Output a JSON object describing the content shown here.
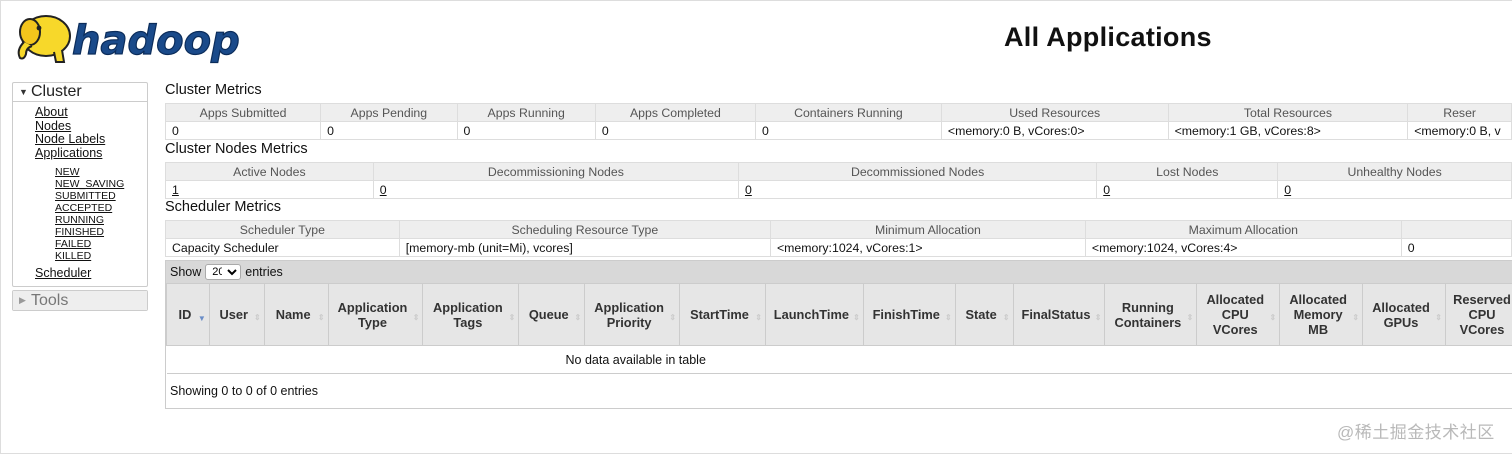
{
  "header": {
    "logo_text": "hadoop",
    "title": "All Applications"
  },
  "nav": {
    "cluster_label": "Cluster",
    "cluster_items": [
      "About",
      "Nodes",
      "Node Labels",
      "Applications"
    ],
    "app_states": [
      "NEW",
      "NEW_SAVING",
      "SUBMITTED",
      "ACCEPTED",
      "RUNNING",
      "FINISHED",
      "FAILED",
      "KILLED"
    ],
    "scheduler": "Scheduler",
    "tools_label": "Tools"
  },
  "cluster_metrics": {
    "title": "Cluster Metrics",
    "headers": [
      "Apps Submitted",
      "Apps Pending",
      "Apps Running",
      "Apps Completed",
      "Containers Running",
      "Used Resources",
      "Total Resources",
      "Reser"
    ],
    "values": [
      "0",
      "0",
      "0",
      "0",
      "0",
      "<memory:0 B, vCores:0>",
      "<memory:1 GB, vCores:8>",
      "<memory:0 B, v"
    ]
  },
  "nodes_metrics": {
    "title": "Cluster Nodes Metrics",
    "headers": [
      "Active Nodes",
      "Decommissioning Nodes",
      "Decommissioned Nodes",
      "Lost Nodes",
      "Unhealthy Nodes"
    ],
    "values": [
      "1",
      "0",
      "0",
      "0",
      "0"
    ]
  },
  "scheduler_metrics": {
    "title": "Scheduler Metrics",
    "headers": [
      "Scheduler Type",
      "Scheduling Resource Type",
      "Minimum Allocation",
      "Maximum Allocation",
      ""
    ],
    "values": [
      "Capacity Scheduler",
      "[memory-mb (unit=Mi), vcores]",
      "<memory:1024, vCores:1>",
      "<memory:1024, vCores:4>",
      "0"
    ]
  },
  "apps_table": {
    "show_label": "Show",
    "page_size": "20",
    "page_size_options": [
      "20"
    ],
    "entries_label": "entries",
    "columns": [
      "ID",
      "User",
      "Name",
      "Application Type",
      "Application Tags",
      "Queue",
      "Application Priority",
      "StartTime",
      "LaunchTime",
      "FinishTime",
      "State",
      "FinalStatus",
      "Running Containers",
      "Allocated CPU VCores",
      "Allocated Memory MB",
      "Allocated GPUs",
      "Reserved CPU VCores"
    ],
    "empty_message": "No data available in table",
    "info": "Showing 0 to 0 of 0 entries"
  },
  "watermark": "@稀土掘金技术社区",
  "colors": {
    "header_bg": "#eeeeee",
    "toolbar_bg": "#d8d8d8",
    "sort_active": "#6a8dc7"
  }
}
